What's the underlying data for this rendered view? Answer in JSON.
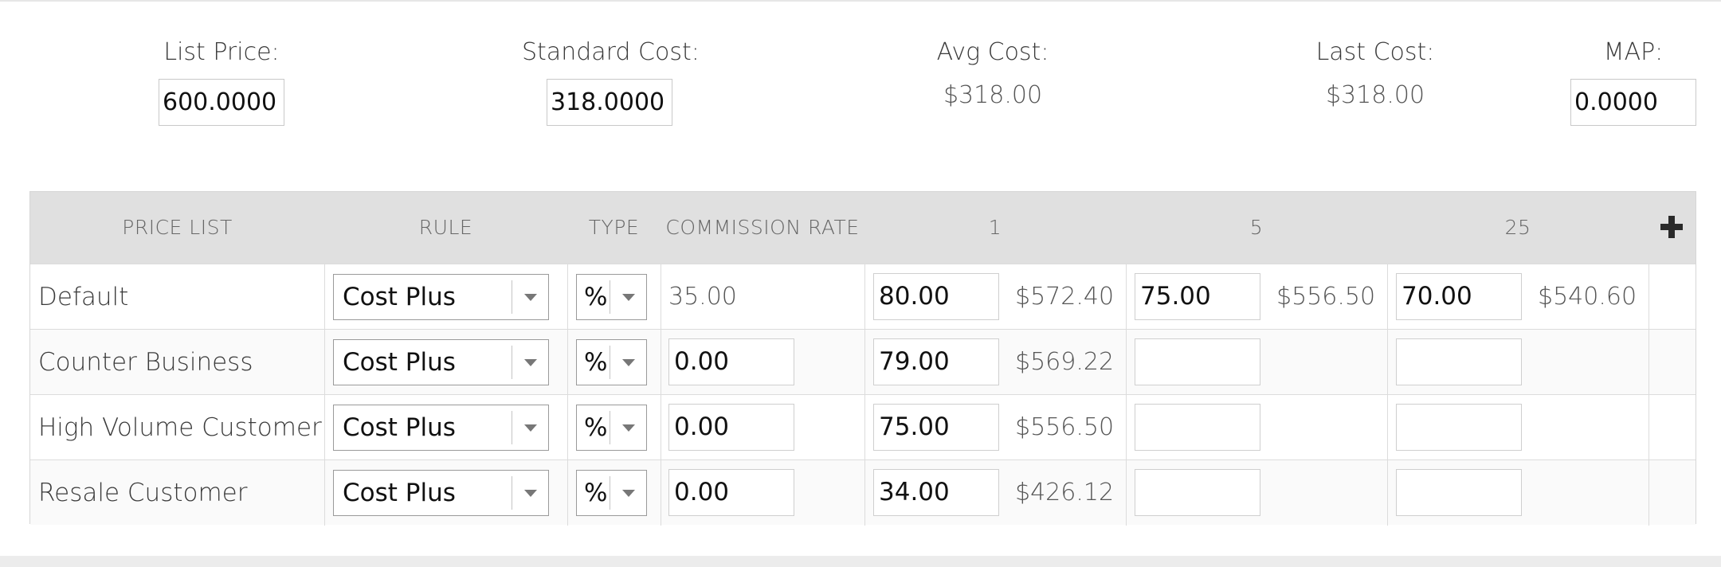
{
  "summary": {
    "list_price": {
      "label": "List Price:",
      "value": "600.0000"
    },
    "standard_cost": {
      "label": "Standard Cost:",
      "value": "318.0000"
    },
    "avg_cost": {
      "label": "Avg Cost:",
      "value": "$318.00"
    },
    "last_cost": {
      "label": "Last Cost:",
      "value": "$318.00"
    },
    "map": {
      "label": "MAP:",
      "value": "0.0000"
    }
  },
  "grid": {
    "headers": {
      "price_list": "PRICE LIST",
      "rule": "RULE",
      "type": "TYPE",
      "commission_rate": "COMMISSION RATE",
      "qty1": "1",
      "qty5": "5",
      "qty25": "25"
    },
    "add_icon": "plus-icon",
    "rows": [
      {
        "name": "Default",
        "rule": "Cost Plus",
        "type": "%",
        "commission": "35.00",
        "q1": "80.00",
        "q1_price": "$572.40",
        "q5": "75.00",
        "q5_price": "$556.50",
        "q25": "70.00",
        "q25_price": "$540.60"
      },
      {
        "name": "Counter Business",
        "rule": "Cost Plus",
        "type": "%",
        "commission": "0.00",
        "q1": "79.00",
        "q1_price": "$569.22",
        "q5": "",
        "q5_price": "",
        "q25": "",
        "q25_price": ""
      },
      {
        "name": "High Volume Customer",
        "rule": "Cost Plus",
        "type": "%",
        "commission": "0.00",
        "q1": "75.00",
        "q1_price": "$556.50",
        "q5": "",
        "q5_price": "",
        "q25": "",
        "q25_price": ""
      },
      {
        "name": "Resale Customer",
        "rule": "Cost Plus",
        "type": "%",
        "commission": "0.00",
        "q1": "34.00",
        "q1_price": "$426.12",
        "q5": "",
        "q5_price": "",
        "q25": "",
        "q25_price": ""
      }
    ]
  }
}
